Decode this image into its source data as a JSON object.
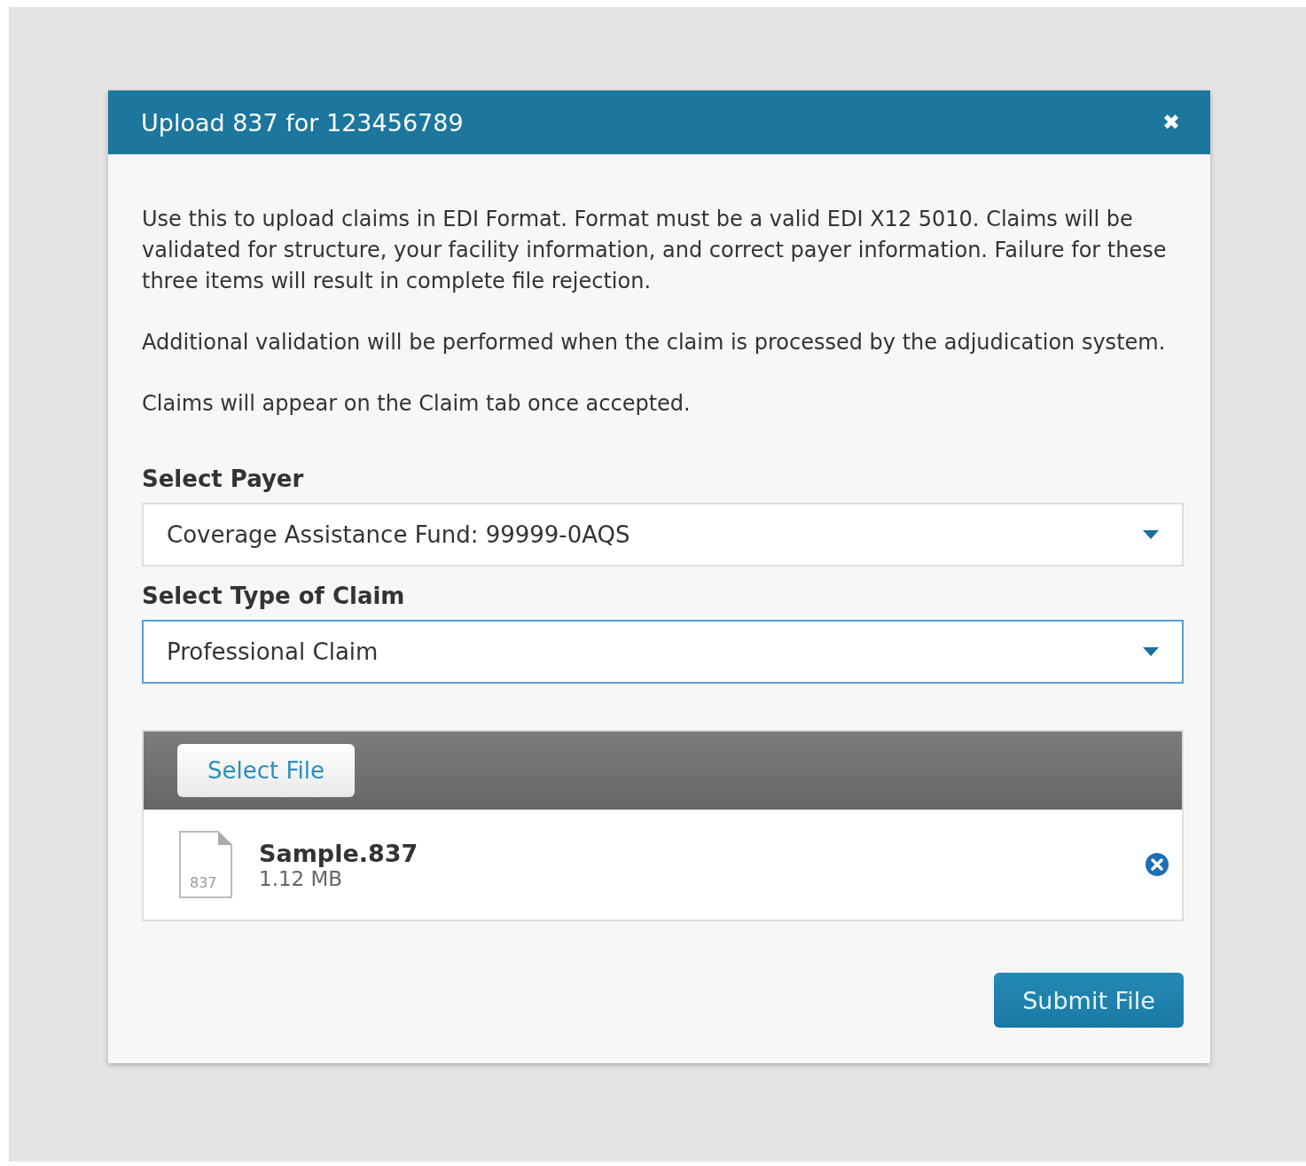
{
  "dialog": {
    "title": "Upload 837 for 123456789",
    "close": "✖"
  },
  "paragraphs": [
    "Use this to upload claims in EDI Format. Format must be a valid EDI X12 5010. Claims will be validated for structure, your facility information, and correct payer information. Failure for these three items will result in complete file rejection.",
    "Additional validation will be performed when the claim is processed by the adjudication system.",
    "Claims will appear on the Claim tab once accepted."
  ],
  "fields": [
    {
      "label": "Select Payer",
      "value": "Coverage Assistance Fund: 99999-0AQS",
      "focused": false
    },
    {
      "label": "Select Type of Claim",
      "value": "Professional Claim",
      "focused": true
    }
  ],
  "upload": {
    "button": "Select File",
    "files": [
      {
        "name": "Sample.837",
        "size": "1.12 MB",
        "icon_label": "837"
      }
    ]
  },
  "submit": "Submit File"
}
